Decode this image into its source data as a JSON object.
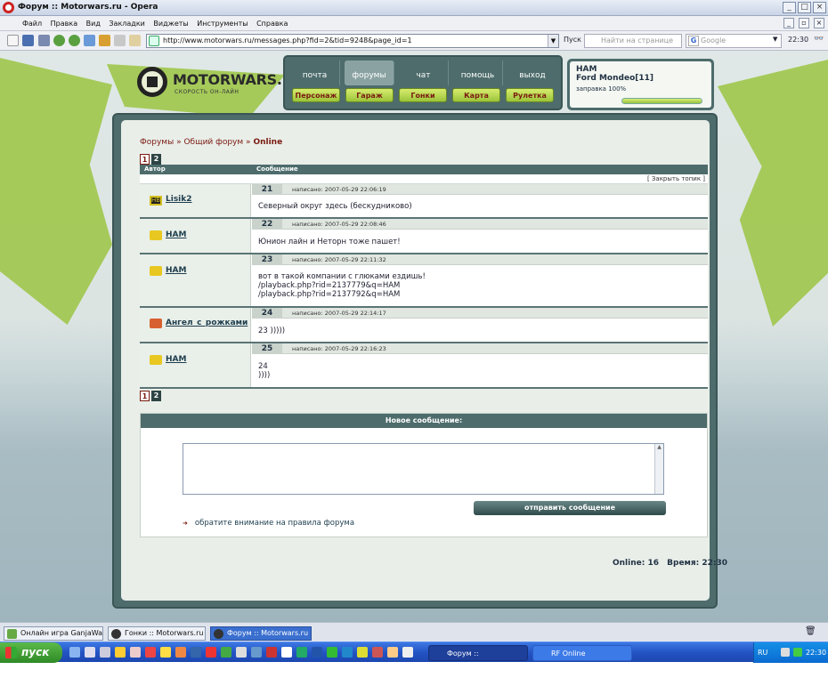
{
  "window": {
    "title": "Форум :: Motorwars.ru - Opera",
    "controls": [
      "_",
      "□",
      "×"
    ],
    "menu": [
      "Файл",
      "Правка",
      "Вид",
      "Закладки",
      "Виджеты",
      "Инструменты",
      "Справка"
    ]
  },
  "toolbar": {
    "url": "http://www.motorwars.ru/messages.php?fid=2&tid=9248&page_id=1",
    "search_label": "Пуск",
    "find_placeholder": "Найти на странице",
    "google_placeholder": "Google",
    "clock": "22:30"
  },
  "site": {
    "logo_text": "MOTORWARS.RU",
    "logo_sub": "СКОРОСТЬ ОН-ЛАЙН",
    "nav_top": [
      "почта",
      "форумы",
      "чат",
      "помощь",
      "выход"
    ],
    "nav_active": "форумы",
    "nav_bottom": [
      "Персонаж",
      "Гараж",
      "Гонки",
      "Карта",
      "Рулетка"
    ],
    "user": {
      "name": "HAM",
      "car": "Ford Mondeo[11]",
      "fuel_label": "заправка 100%",
      "fuel_level": 1.0
    }
  },
  "forum": {
    "breadcrumb": {
      "a": "Форумы",
      "sep": "»",
      "b": "Общий форум",
      "c": "Online"
    },
    "pages": [
      "1",
      "2"
    ],
    "current_page": "1",
    "col_author": "Автор",
    "col_message": "Сообщение",
    "close_topic": "[ Закрыть топик ]",
    "posts": [
      {
        "num": "21",
        "author": "Lisik2",
        "icon": "clan-badge-icon",
        "date": "написано: 2007-05-29 22:06:19",
        "lines": [
          "Северный округ здесь (бескудниково)"
        ]
      },
      {
        "num": "22",
        "author": "HAM",
        "icon": "ferrari-horse-icon",
        "date": "написано: 2007-05-29 22:08:46",
        "lines": [
          "Юнион лайн и Неторн тоже пашет!"
        ]
      },
      {
        "num": "23",
        "author": "HAM",
        "icon": "ferrari-horse-icon",
        "date": "написано: 2007-05-29 22:11:32",
        "lines": [
          "вот в такой компании с глюками ездишь!",
          "/playback.php?rid=2137779&q=HAM",
          "/playback.php?rid=2137792&q=HAM"
        ]
      },
      {
        "num": "24",
        "author": "Ангел_с_рожками",
        "icon": "angel-avatar-icon",
        "date": "написано: 2007-05-29 22:14:17",
        "lines": [
          "23 )))))"
        ]
      },
      {
        "num": "25",
        "author": "HAM",
        "icon": "ferrari-horse-icon",
        "date": "написано: 2007-05-29 22:16:23",
        "lines": [
          "24",
          "))))"
        ]
      }
    ],
    "new_message": "Новое сообщение:",
    "send_button": "отправить сообщение",
    "rules_link": "обратите внимание на правила форума",
    "online": "Online: 16",
    "time": "Время: 22:30"
  },
  "taskbar": {
    "tabs": [
      "Онлайн игра GanjaWars....",
      "Гонки :: Motorwars.ru",
      "Форум :: Motorwars.ru"
    ],
    "active_tab": "Форум :: Motorwars.ru",
    "start": "пуск",
    "windows": [
      "Форум :: Motorwars....",
      "RF Online"
    ],
    "lang": "RU",
    "clock": "22:30"
  },
  "colors": {
    "accent": "#4e6c6c",
    "link": "#7a1a10",
    "lime": "#9bc442"
  }
}
